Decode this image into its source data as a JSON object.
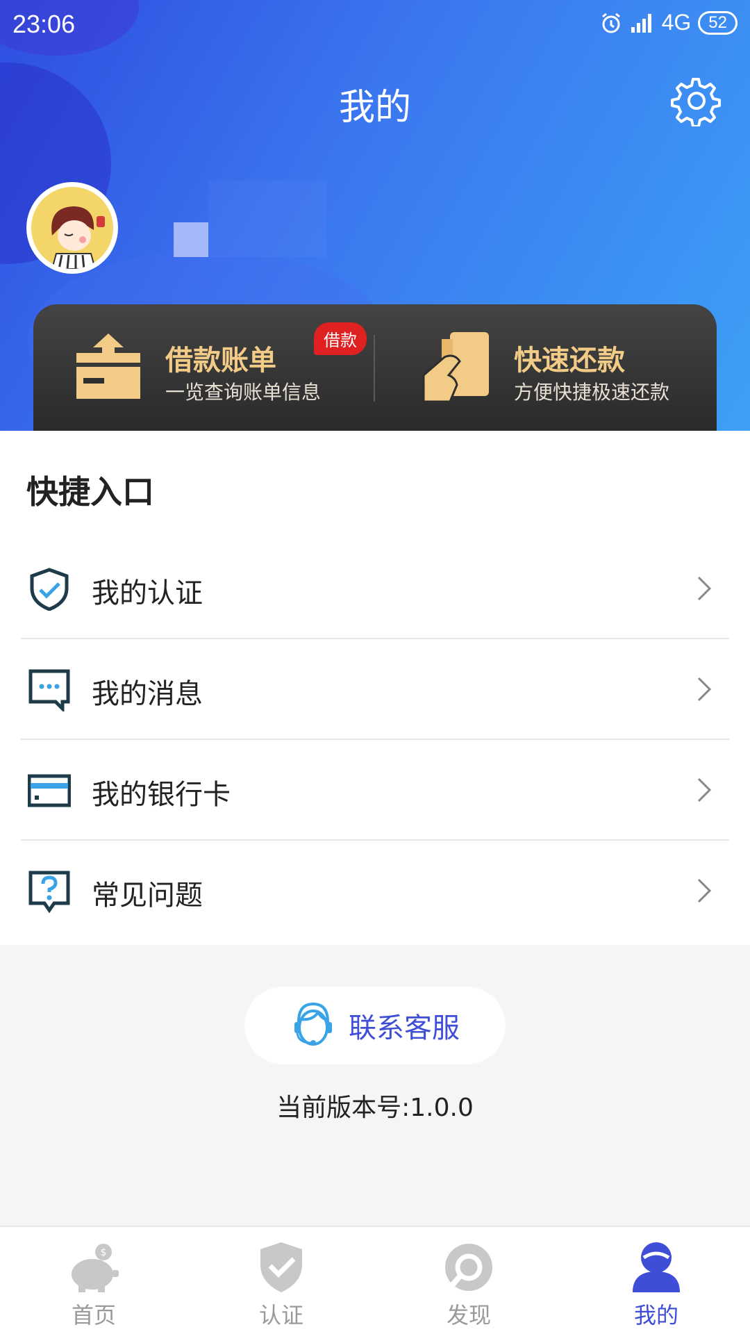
{
  "status_bar": {
    "time": "23:06",
    "network": "4G",
    "battery": "52"
  },
  "header": {
    "title": "我的"
  },
  "cards": {
    "bill": {
      "title": "借款账单",
      "subtitle": "一览查询账单信息",
      "badge": "借款"
    },
    "repay": {
      "title": "快速还款",
      "subtitle": "方便快捷极速还款"
    }
  },
  "quick": {
    "title": "快捷入口",
    "items": [
      {
        "label": "我的认证",
        "icon": "shield-check-icon"
      },
      {
        "label": "我的消息",
        "icon": "message-icon"
      },
      {
        "label": "我的银行卡",
        "icon": "bank-card-icon"
      },
      {
        "label": "常见问题",
        "icon": "question-icon"
      }
    ]
  },
  "support": {
    "label": "联系客服"
  },
  "version": "当前版本号:1.0.0",
  "tabs": [
    {
      "label": "首页",
      "icon": "piggy-bank-icon"
    },
    {
      "label": "认证",
      "icon": "shield-icon"
    },
    {
      "label": "发现",
      "icon": "discover-icon"
    },
    {
      "label": "我的",
      "icon": "user-icon",
      "active": true
    }
  ],
  "colors": {
    "accent": "#3f4ed6",
    "gold": "#f2cc87",
    "inactive": "#9a9a9a"
  }
}
